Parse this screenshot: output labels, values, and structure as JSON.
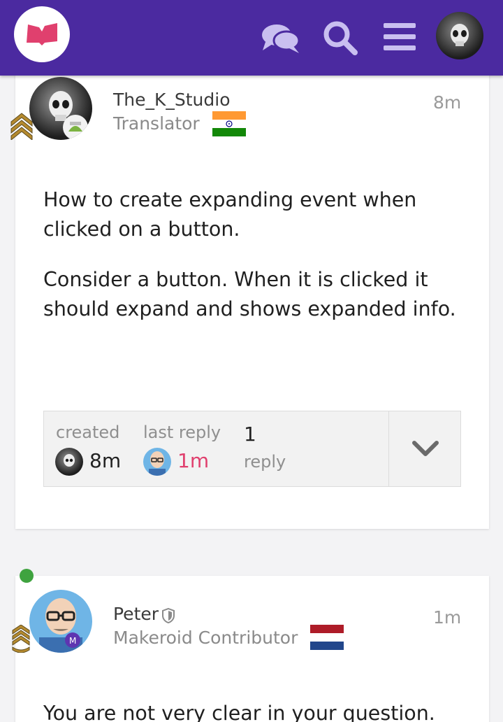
{
  "header": {
    "logo_icon": "forum-logo-icon",
    "icons": [
      "chat-icon",
      "search-icon",
      "hamburger-menu-icon",
      "user-avatar"
    ],
    "accent_color": "#4b2aa0"
  },
  "posts": [
    {
      "username": "The_K_Studio",
      "user_title": "Translator",
      "flag": "India",
      "time": "8m",
      "paragraphs": [
        "How to create expanding event when clicked on a button.",
        "Consider a button. When it is clicked it should expand and shows expanded info."
      ],
      "actions": [
        "emoji-icon",
        "link-icon",
        "edit-icon",
        "more-icon",
        "reply-icon"
      ]
    },
    {
      "username": "Peter",
      "user_title": "Makeroid Contributor",
      "flag": "Netherlands",
      "time": "1m",
      "paragraphs": [
        "You are not very clear in your question."
      ]
    }
  ],
  "topic_map": {
    "created_label": "created",
    "created_time": "8m",
    "last_reply_label": "last reply",
    "last_reply_time": "1m",
    "replies_count": "1",
    "replies_label": "reply",
    "last_reply_color": "#e0406e"
  }
}
